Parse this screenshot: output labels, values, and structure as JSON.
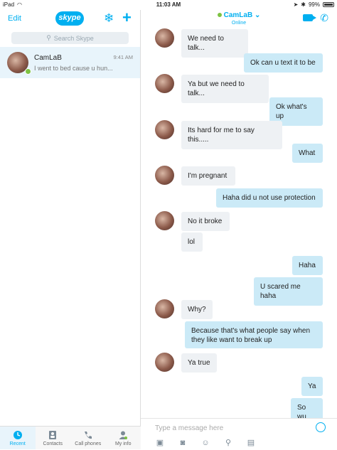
{
  "status_bar": {
    "device": "iPad",
    "time": "11:03 AM",
    "battery": "99%"
  },
  "left_pane": {
    "edit_label": "Edit",
    "logo_text": "skype",
    "search_placeholder": "Search Skype",
    "conversation": {
      "name": "CamLaB",
      "time": "9:41 AM",
      "preview": "I went to bed cause u hun..."
    },
    "tabs": [
      {
        "label": "Recent",
        "icon": "clock-icon"
      },
      {
        "label": "Contacts",
        "icon": "contacts-icon"
      },
      {
        "label": "Call phones",
        "icon": "dialpad-icon"
      },
      {
        "label": "My info",
        "icon": "person-icon"
      }
    ]
  },
  "chat": {
    "title": "CamLaB",
    "subtitle": "Online",
    "messages": [
      {
        "side": "in",
        "text": "We need to talk..."
      },
      {
        "side": "out",
        "text": "Ok can u text it to be"
      },
      {
        "side": "in",
        "text": "Ya but we need to talk..."
      },
      {
        "side": "out",
        "text": "Ok what's up"
      },
      {
        "side": "in",
        "text": "Its hard for me to say this....."
      },
      {
        "side": "out",
        "text": "What"
      },
      {
        "side": "in",
        "text": "I'm pregnant"
      },
      {
        "side": "out",
        "text": "Haha did u not use protection"
      },
      {
        "side": "in",
        "text": "No it broke"
      },
      {
        "side": "in",
        "text": "lol"
      },
      {
        "side": "out",
        "text": "Haha"
      },
      {
        "side": "out",
        "text": "U scared me haha"
      },
      {
        "side": "in",
        "text": "Why?"
      },
      {
        "side": "out",
        "text": "Because that's what people say when they like want to break up"
      },
      {
        "side": "in",
        "text": "Ya true"
      },
      {
        "side": "out",
        "text": "Ya"
      },
      {
        "side": "out",
        "text": "So wu"
      }
    ],
    "composer_placeholder": "Type a message here"
  }
}
